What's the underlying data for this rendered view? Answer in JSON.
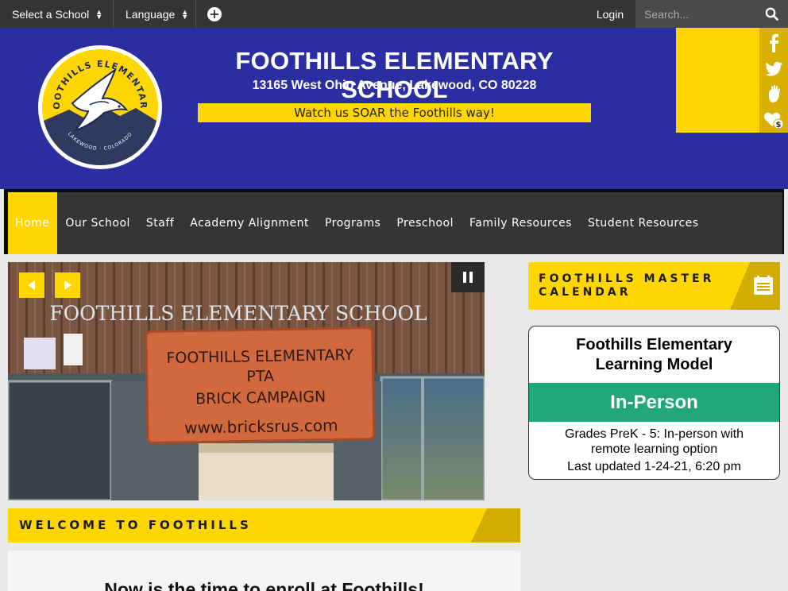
{
  "topbar": {
    "school_select": "Select a School",
    "language_select": "Language",
    "login": "Login",
    "search_placeholder": "Search..."
  },
  "header": {
    "school_name": "FOOTHILLS ELEMENTARY SCHOOL",
    "address": "13165 West Ohio Avenue, Lakewood, CO 80228",
    "tagline": "Watch us SOAR the Foothills way!",
    "logo": {
      "ring_text": "FOOTHILLS ELEMENTARY",
      "bottom_text": "LAKEWOOD · COLORADO"
    },
    "social": [
      "facebook-icon",
      "twitter-icon",
      "hand-icon",
      "donate-icon"
    ]
  },
  "nav": {
    "items": [
      "Home",
      "Our School",
      "Staff",
      "Academy Alignment",
      "Programs",
      "Preschool",
      "Family Resources",
      "Student Resources"
    ],
    "active": "Home"
  },
  "slideshow": {
    "sign_text": "FOOTHILLS ELEMENTARY SCHOOL",
    "brick_lines": [
      "FOOTHILLS ELEMENTARY",
      "PTA",
      "BRICK CAMPAIGN",
      "www.bricksrus.com"
    ]
  },
  "sections": {
    "welcome": "WELCOME TO FOOTHILLS",
    "calendar_line1": "FOOTHILLS MASTER",
    "calendar_line2": "CALENDAR"
  },
  "learning_model": {
    "title": "Foothills Elementary Learning Model",
    "status": "In-Person",
    "description": "Grades PreK - 5: In-person with remote learning option",
    "updated": "Last updated 1-24-21, 6:20 pm"
  },
  "welcome_panel": {
    "headline": "Now is the time to enroll at Foothills!"
  },
  "colors": {
    "brand_blue": "#2b2ea0",
    "brand_yellow": "#ffd600",
    "status_green": "#21a77b",
    "dark_bar": "#343434"
  }
}
